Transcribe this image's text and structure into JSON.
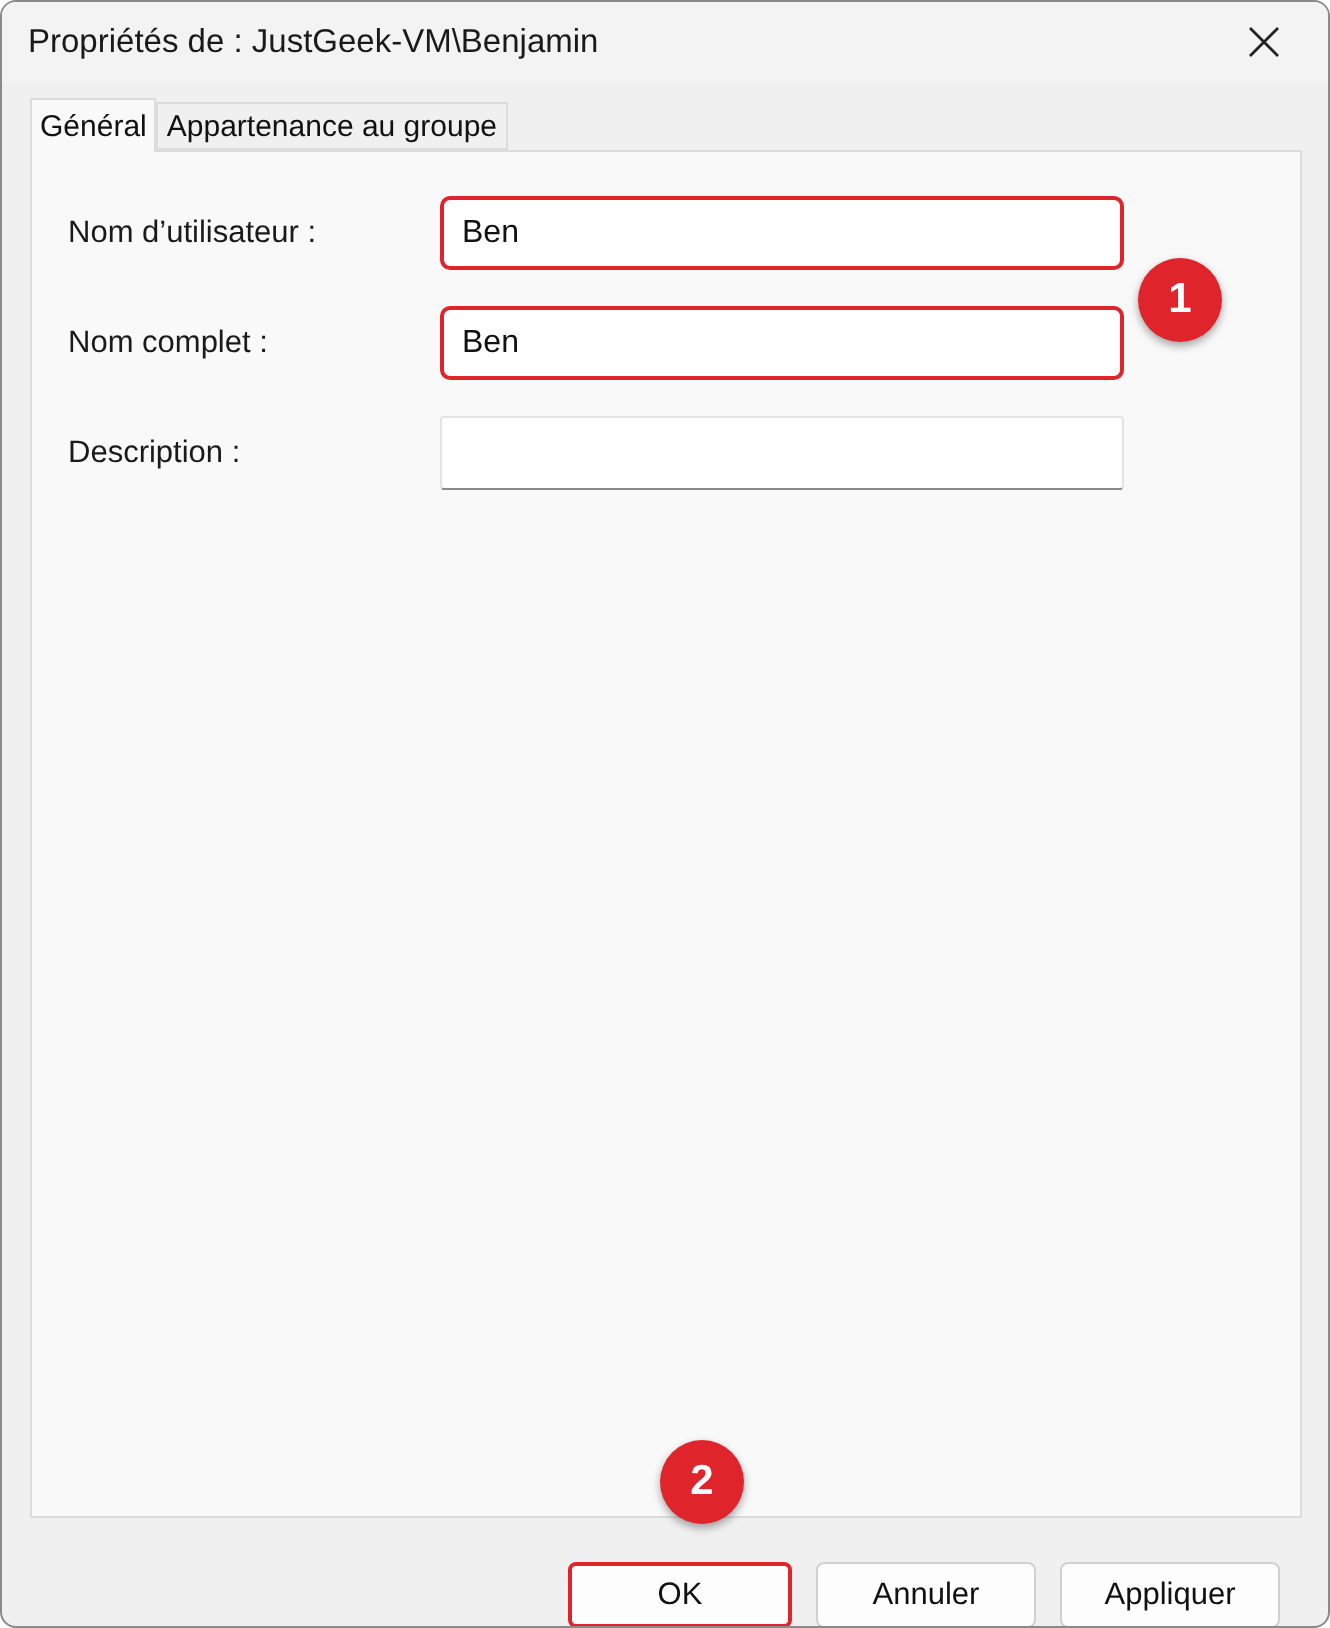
{
  "window": {
    "title": "Propriétés de : JustGeek-VM\\Benjamin"
  },
  "tabs": [
    {
      "label": "Général",
      "selected": true
    },
    {
      "label": "Appartenance au groupe",
      "selected": false
    }
  ],
  "fields": [
    {
      "label": "Nom d’utilisateur :",
      "value": "Ben",
      "highlighted": true
    },
    {
      "label": "Nom complet :",
      "value": "Ben",
      "highlighted": true
    },
    {
      "label": "Description :",
      "highlighted": false
    }
  ],
  "callouts": [
    {
      "number": "1"
    },
    {
      "number": "2"
    }
  ],
  "buttons": [
    {
      "label": "OK",
      "highlighted": true
    },
    {
      "label": "Annuler",
      "highlighted": false
    },
    {
      "label": "Appliquer",
      "highlighted": false
    }
  ]
}
